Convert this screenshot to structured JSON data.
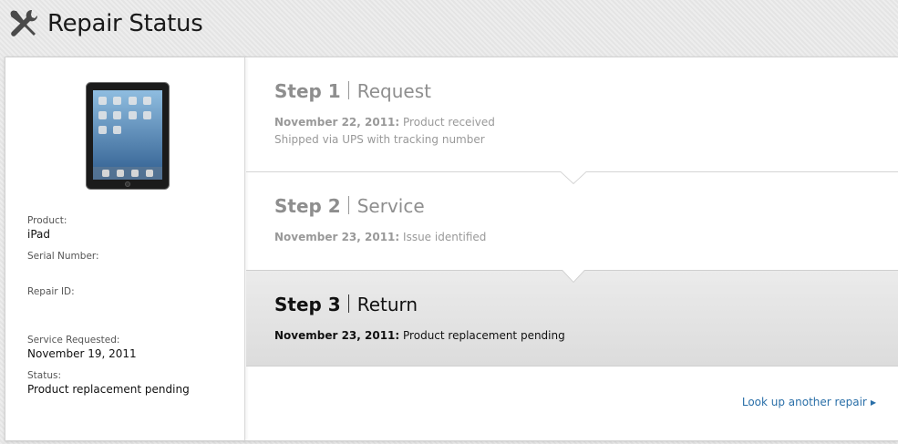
{
  "header": {
    "title": "Repair Status",
    "icon": "tools-icon"
  },
  "sidebar": {
    "product_label": "Product:",
    "product_value": "iPad",
    "serial_label": "Serial Number:",
    "serial_value": "",
    "repair_id_label": "Repair ID:",
    "repair_id_value": "",
    "service_requested_label": "Service Requested:",
    "service_requested_value": "November 19, 2011",
    "status_label": "Status:",
    "status_value": "Product replacement pending"
  },
  "steps": [
    {
      "number": "Step 1",
      "name": "Request",
      "date": "November 22, 2011:",
      "text": " Product received",
      "extra": "Shipped via UPS with tracking number",
      "active": false
    },
    {
      "number": "Step 2",
      "name": "Service",
      "date": "November 23, 2011:",
      "text": " Issue identified",
      "extra": "",
      "active": false
    },
    {
      "number": "Step 3",
      "name": "Return",
      "date": "November 23, 2011:",
      "text": " Product replacement pending",
      "extra": "",
      "active": true
    }
  ],
  "lookup_link": "Look up another repair",
  "colors": {
    "accent_link": "#2a6fa8",
    "active_step_bg": "#e0e0e0",
    "inactive_text": "#8e8e8e"
  }
}
